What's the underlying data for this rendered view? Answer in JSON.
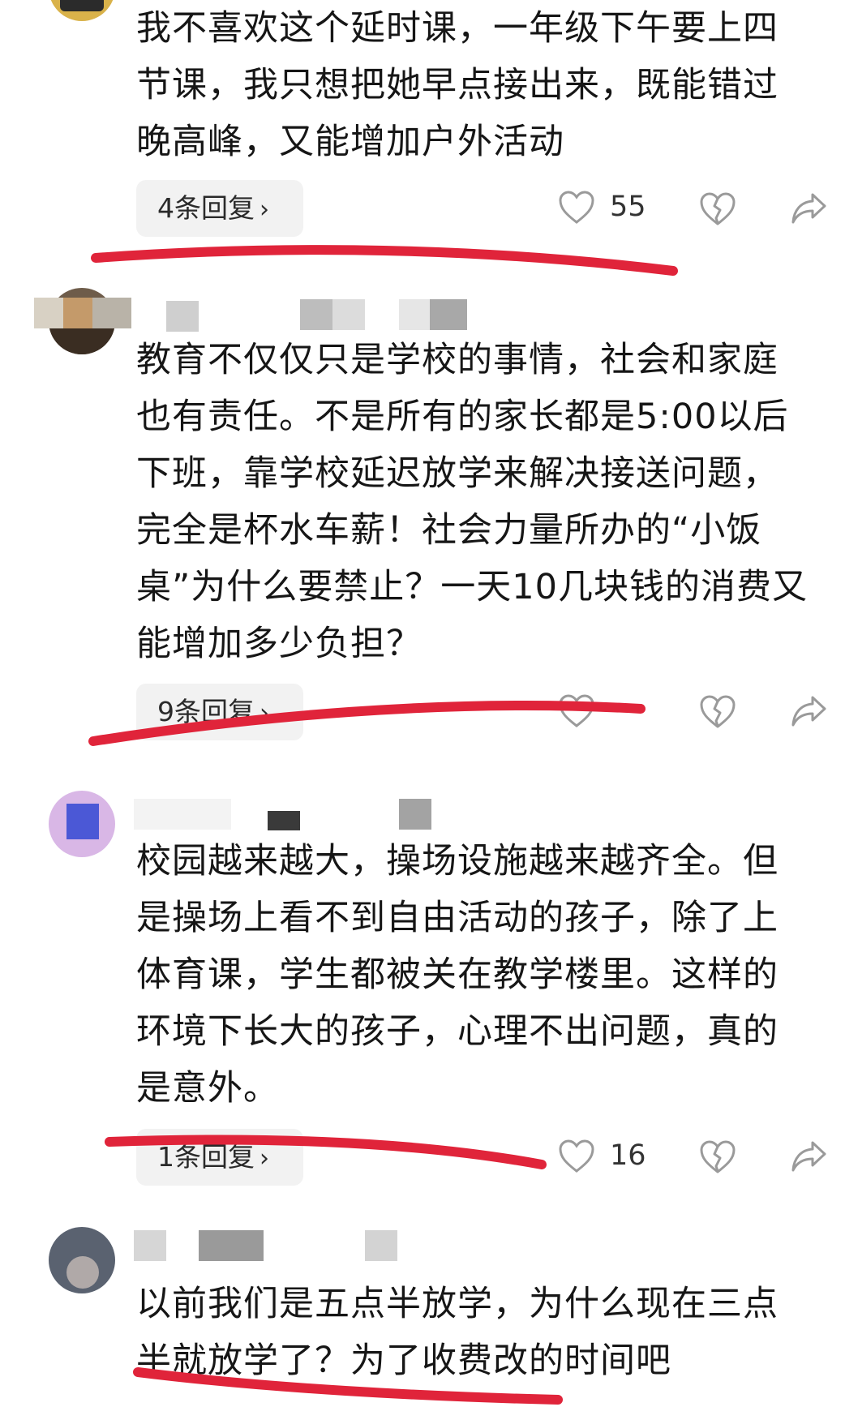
{
  "comments": [
    {
      "text": "我不喜欢这个延时课，一年级下午要上四节课，我只想把她早点接出来，既能错过晚高峰，又能增加户外活动",
      "reply_label": "4条回复",
      "likes": "55"
    },
    {
      "text": "教育不仅仅只是学校的事情，社会和家庭也有责任。不是所有的家长都是5:00以后下班，靠学校延迟放学来解决接送问题，完全是杯水车薪！社会力量所办的“小饭桌”为什么要禁止？一天10几块钱的消费又能增加多少负担？",
      "reply_label": "9条回复",
      "likes": ""
    },
    {
      "text": "校园越来越大，操场设施越来越齐全。但是操场上看不到自由活动的孩子，除了上体育课，学生都被关在教学楼里。这样的环境下长大的孩子，心理不出问题，真的是意外。",
      "reply_label": "1条回复",
      "likes": "16"
    },
    {
      "text": "以前我们是五点半放学，为什么现在三点半就放学了？为了收费改的时间吧"
    }
  ],
  "icons": {
    "like": "heart-outline-icon",
    "dislike": "broken-heart-icon",
    "share": "share-arrow-icon",
    "chevron": "chevron-right-icon"
  },
  "colors": {
    "annotation_red": "#e0243a",
    "reply_bg": "#f2f2f2",
    "icon_gray": "#9a9a9a"
  }
}
